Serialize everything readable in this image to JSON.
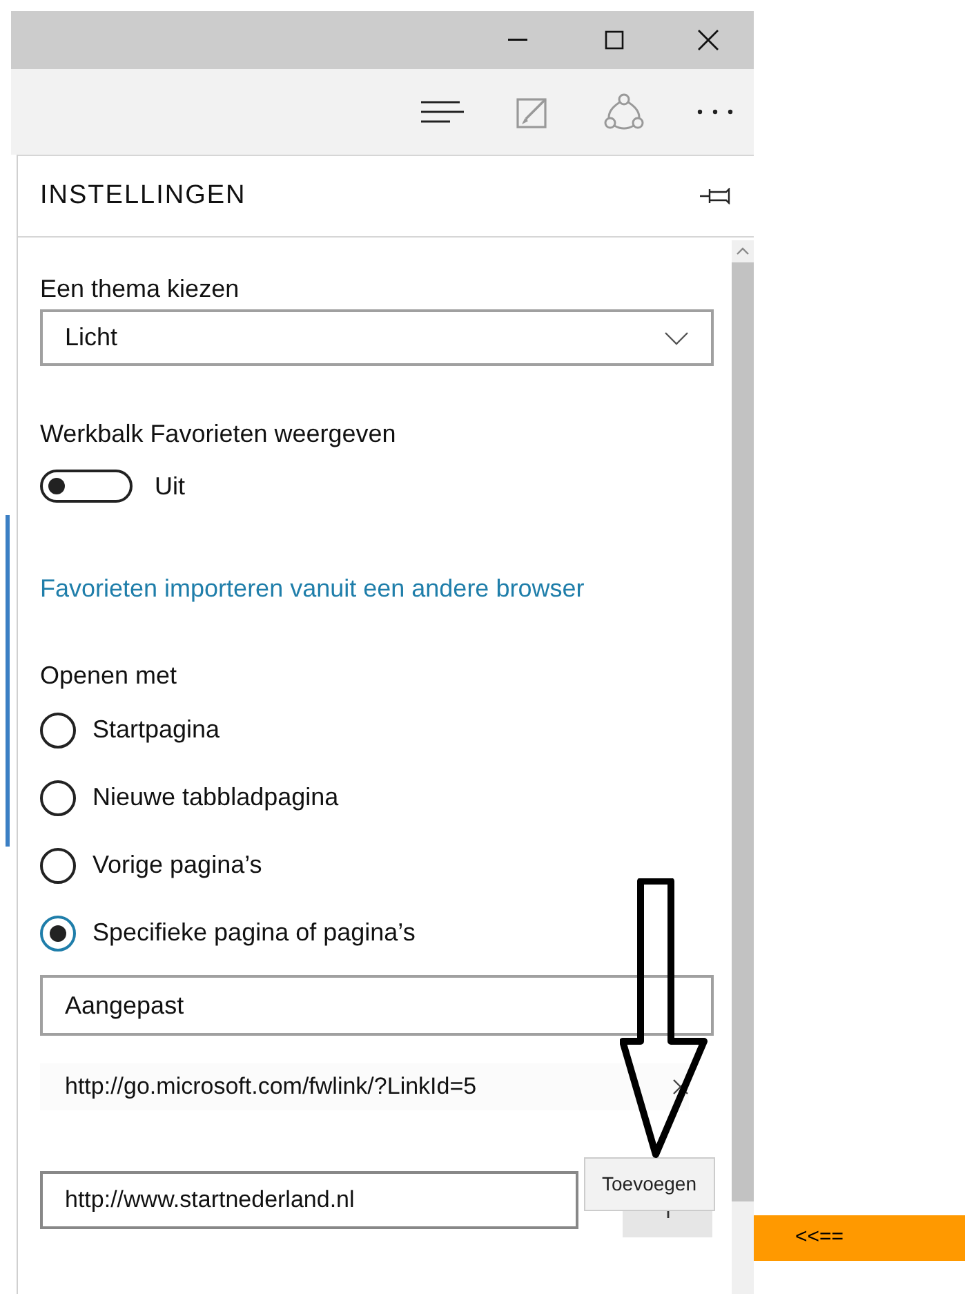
{
  "panel": {
    "title": "INSTELLINGEN"
  },
  "theme": {
    "label": "Een thema kiezen",
    "value": "Licht"
  },
  "favorites_bar": {
    "label": "Werkbalk Favorieten weergeven",
    "on": false,
    "state_text": "Uit"
  },
  "import_link": "Favorieten importeren vanuit een andere browser",
  "open_with": {
    "label": "Openen met",
    "options": [
      {
        "label": "Startpagina",
        "selected": false
      },
      {
        "label": "Nieuwe tabbladpagina",
        "selected": false
      },
      {
        "label": "Vorige pagina’s",
        "selected": false
      },
      {
        "label": "Specifieke pagina of pagina’s",
        "selected": true
      }
    ]
  },
  "pages_dropdown": {
    "value": "Aangepast"
  },
  "page_url": "http://go.microsoft.com/fwlink/?LinkId=5",
  "new_page": {
    "value": "http://www.startnederland.nl"
  },
  "tooltip": "Toevoegen",
  "annotation": "<<=="
}
